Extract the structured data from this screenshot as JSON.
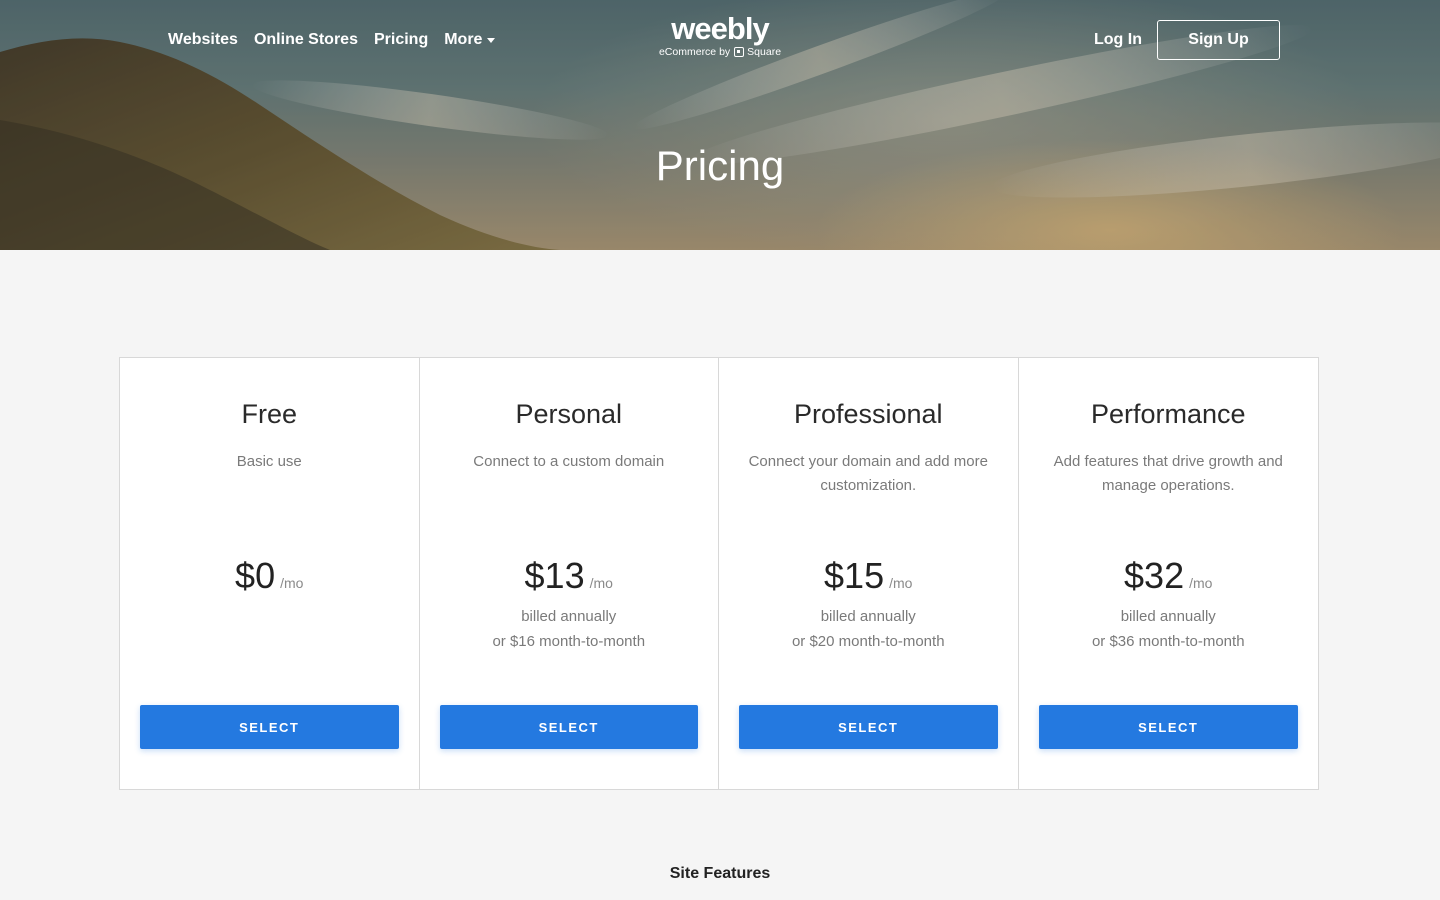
{
  "nav": {
    "links": [
      "Websites",
      "Online Stores",
      "Pricing"
    ],
    "more_label": "More",
    "login_label": "Log In",
    "signup_label": "Sign Up"
  },
  "logo": {
    "wordmark": "weebly",
    "tagline_prefix": "eCommerce by",
    "tagline_brand": "Square"
  },
  "hero": {
    "title": "Pricing"
  },
  "plans": [
    {
      "name": "Free",
      "description": "Basic use",
      "price": "$0",
      "period": "/mo",
      "billing_line1": "",
      "billing_line2": "",
      "button_label": "SELECT"
    },
    {
      "name": "Personal",
      "description": "Connect to a custom domain",
      "price": "$13",
      "period": "/mo",
      "billing_line1": "billed annually",
      "billing_line2": "or $16 month-to-month",
      "button_label": "SELECT"
    },
    {
      "name": "Professional",
      "description": "Connect your domain and add more customization.",
      "price": "$15",
      "period": "/mo",
      "billing_line1": "billed annually",
      "billing_line2": "or $20 month-to-month",
      "button_label": "SELECT"
    },
    {
      "name": "Performance",
      "description": "Add features that drive growth and manage operations.",
      "price": "$32",
      "period": "/mo",
      "billing_line1": "billed annually",
      "billing_line2": "or $36 month-to-month",
      "button_label": "SELECT"
    }
  ],
  "section": {
    "features_title": "Site Features"
  },
  "colors": {
    "accent": "#2479e0",
    "page_background": "#f5f5f5",
    "card_border": "#d8d8d8"
  }
}
